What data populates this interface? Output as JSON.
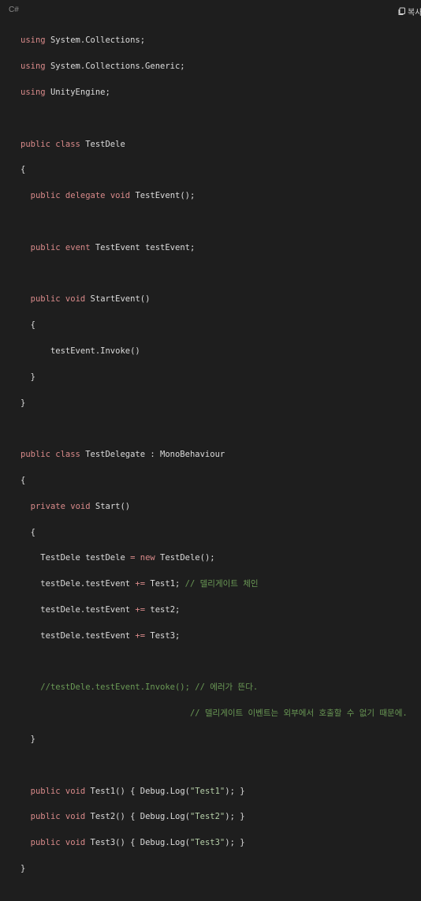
{
  "header": {
    "language": "C#",
    "copy_label": "복사"
  },
  "code": {
    "l1": [
      "using",
      "System.Collections;"
    ],
    "l2": [
      "using",
      "System.Collections.Generic;"
    ],
    "l3": [
      "using",
      "UnityEngine;"
    ],
    "l5": [
      "public",
      "class",
      "TestDele"
    ],
    "l6": "{",
    "l7": [
      "public",
      "delegate",
      "void",
      "TestEvent();"
    ],
    "l9": [
      "public",
      "event",
      "TestEvent testEvent;"
    ],
    "l11": [
      "public",
      "void",
      "StartEvent()"
    ],
    "l12": "{",
    "l13": "testEvent.Invoke()",
    "l14": "}",
    "l15": "}",
    "l17": [
      "public",
      "class",
      "TestDelegate : MonoBehaviour"
    ],
    "l18": "{",
    "l19": [
      "private",
      "void",
      "Start()"
    ],
    "l20": "{",
    "l21": [
      "TestDele testDele",
      "=",
      "new",
      "TestDele();"
    ],
    "l22": [
      "testDele.testEvent",
      "+=",
      "Test1;",
      "// 델리게이트 체인"
    ],
    "l23": [
      "testDele.testEvent",
      "+=",
      "test2;"
    ],
    "l24": [
      "testDele.testEvent",
      "+=",
      "Test3;"
    ],
    "l26": "//testDele.testEvent.Invoke(); // 에러가 뜬다.",
    "l27": "// 델리게이트 이벤트는 외부에서 호출할 수 없기 때문에.",
    "l28": "}",
    "l30": [
      "public",
      "void",
      "Test1() { Debug.Log(",
      "\"Test1\"",
      "); }"
    ],
    "l31": [
      "public",
      "void",
      "Test2() { Debug.Log(",
      "\"Test2\"",
      "); }"
    ],
    "l32": [
      "public",
      "void",
      "Test3() { Debug.Log(",
      "\"Test3\"",
      "); }"
    ],
    "l33": "}"
  }
}
